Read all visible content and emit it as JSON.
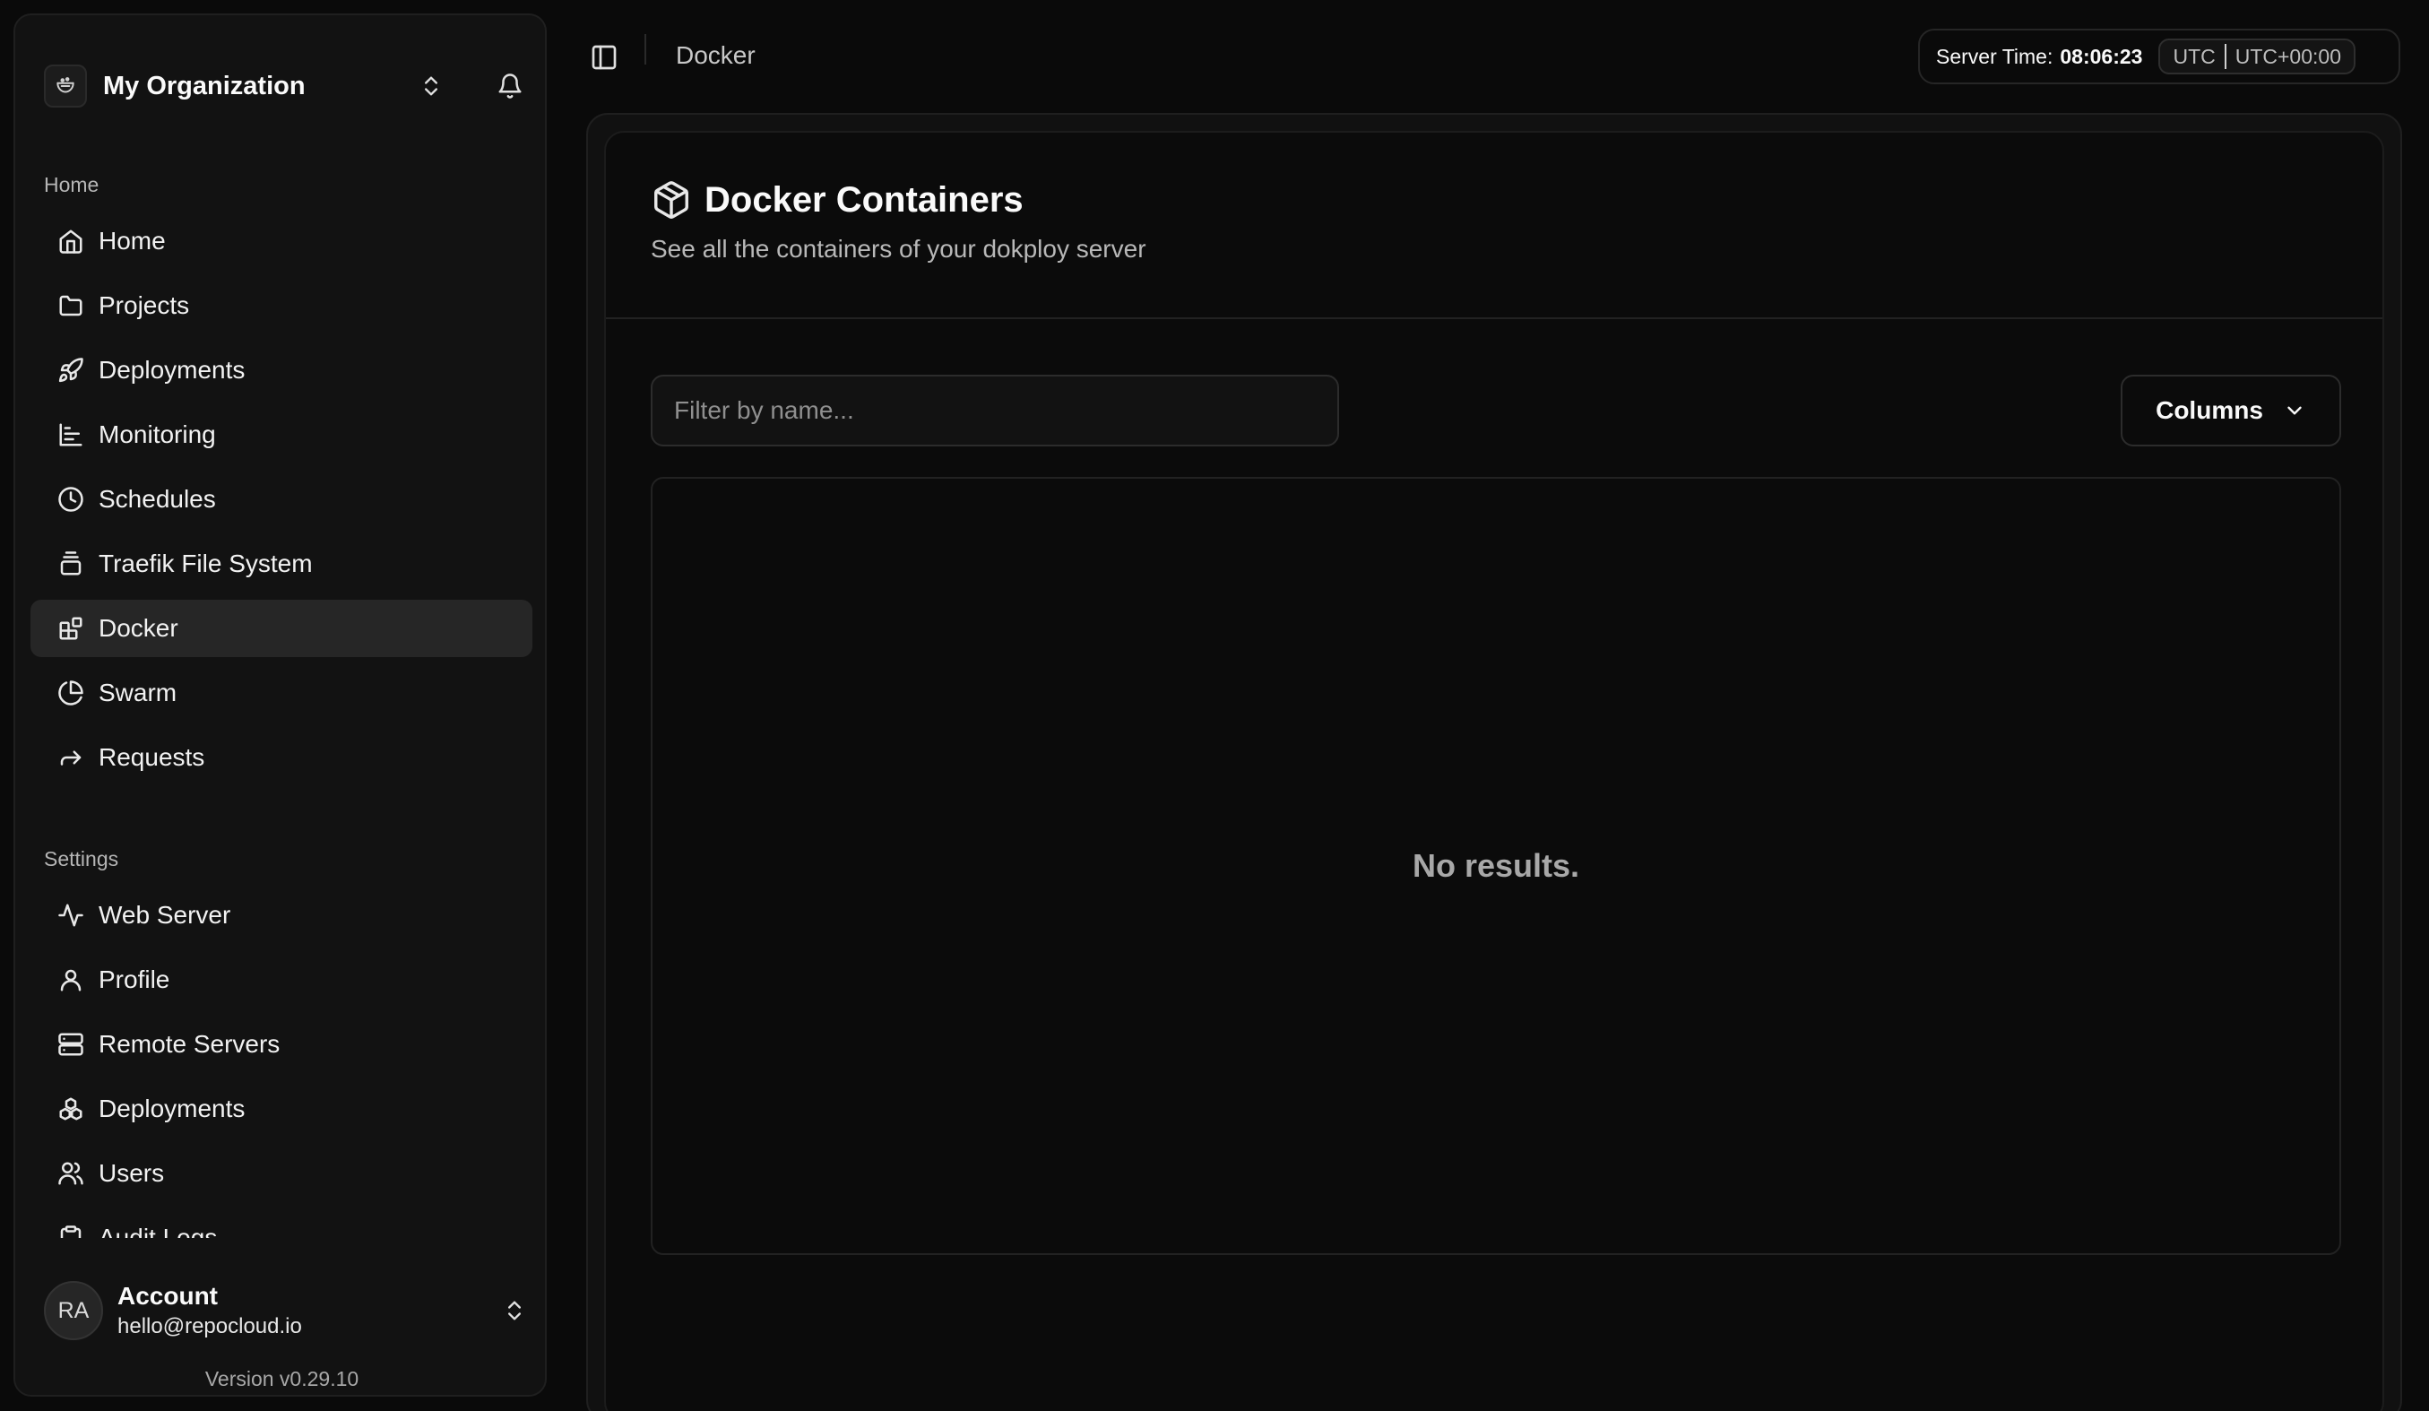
{
  "sidebar": {
    "org_name": "My Organization",
    "home_section_label": "Home",
    "home_items": [
      {
        "label": "Home",
        "icon": "home-icon"
      },
      {
        "label": "Projects",
        "icon": "folder-icon"
      },
      {
        "label": "Deployments",
        "icon": "rocket-icon"
      },
      {
        "label": "Monitoring",
        "icon": "bar-chart-icon"
      },
      {
        "label": "Schedules",
        "icon": "clock-icon"
      },
      {
        "label": "Traefik File System",
        "icon": "layers-icon"
      },
      {
        "label": "Docker",
        "icon": "blocks-icon",
        "active": true
      },
      {
        "label": "Swarm",
        "icon": "pie-chart-icon"
      },
      {
        "label": "Requests",
        "icon": "forward-icon"
      }
    ],
    "settings_section_label": "Settings",
    "settings_items": [
      {
        "label": "Web Server",
        "icon": "activity-icon"
      },
      {
        "label": "Profile",
        "icon": "user-icon"
      },
      {
        "label": "Remote Servers",
        "icon": "server-icon"
      },
      {
        "label": "Deployments",
        "icon": "boxes-icon"
      },
      {
        "label": "Users",
        "icon": "users-icon"
      },
      {
        "label": "Audit Logs",
        "icon": "clipboard-icon"
      }
    ],
    "account": {
      "initials": "RA",
      "name": "Account",
      "email": "hello@repocloud.io"
    },
    "version": "Version v0.29.10"
  },
  "topbar": {
    "breadcrumb": "Docker",
    "server_time_label": "Server Time:",
    "server_time_value": "08:06:23",
    "timezone": "UTC",
    "timezone_offset": "UTC+00:00"
  },
  "main": {
    "title": "Docker Containers",
    "subtitle": "See all the containers of your dokploy server",
    "filter_placeholder": "Filter by name...",
    "columns_button": "Columns",
    "empty_message": "No results."
  },
  "colors": {
    "background": "#0a0a0a",
    "sidebar_bg": "#121212",
    "active_item_bg": "#262626",
    "text_primary": "#fafafa",
    "text_muted": "#a8a8a8"
  }
}
